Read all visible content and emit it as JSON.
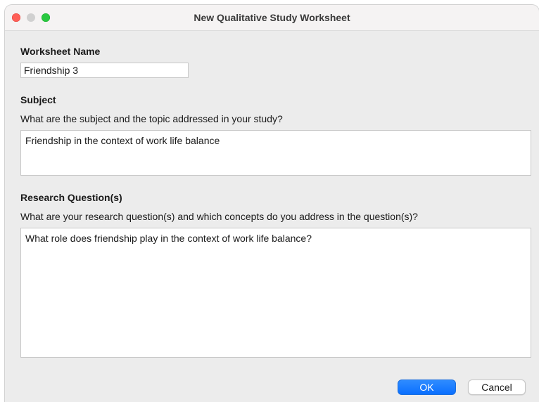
{
  "window": {
    "title": "New Qualitative Study Worksheet"
  },
  "worksheet_name": {
    "label": "Worksheet Name",
    "value": "Friendship 3"
  },
  "subject": {
    "label": "Subject",
    "prompt": "What are the subject and the topic addressed in your study?",
    "value": "Friendship in the context of work life balance"
  },
  "research_questions": {
    "label": "Research Question(s)",
    "prompt": "What are your research question(s) and which concepts do you address in the question(s)?",
    "value": "What role does friendship play in the context of work life balance?"
  },
  "buttons": {
    "ok_label": "OK",
    "cancel_label": "Cancel"
  },
  "colors": {
    "accent": "#0a6fff",
    "close": "#ff5f57",
    "maximize": "#28c840",
    "minimize_inactive": "#d0d0d0"
  }
}
